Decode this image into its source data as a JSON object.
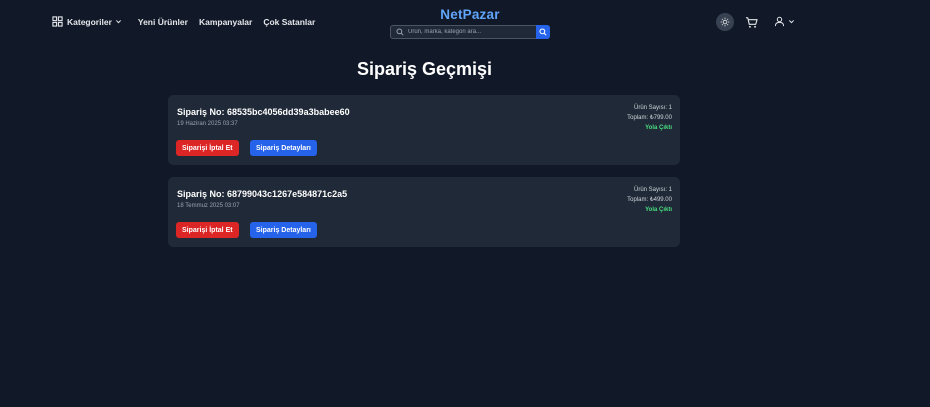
{
  "header": {
    "brand": "NetPazar",
    "nav": {
      "categories_label": "Kategoriler",
      "new_products_label": "Yeni Ürünler",
      "campaigns_label": "Kampanyalar",
      "best_sellers_label": "Çok Satanlar"
    },
    "search": {
      "placeholder": "Ürün, marka, kategori ara..."
    },
    "icons": [
      "grid-icon",
      "chevron-down-icon",
      "search-icon",
      "sun-icon",
      "cart-icon",
      "user-icon"
    ]
  },
  "page": {
    "title": "Sipariş Geçmişi"
  },
  "orders": [
    {
      "number": "Sipariş No: 68535bc4056dd39a3babee60",
      "date": "19 Haziran 2025 03:37",
      "item_count": "Ürün Sayısı: 1",
      "total": "Toplam: ₺799.00",
      "status": "Yola Çıktı",
      "cancel_label": "Siparişi İptal Et",
      "details_label": "Sipariş Detayları"
    },
    {
      "number": "Sipariş No: 68799043c1267e584871c2a5",
      "date": "18 Temmuz 2025 03:07",
      "item_count": "Ürün Sayısı: 1",
      "total": "Toplam: ₺499.00",
      "status": "Yola Çıktı",
      "cancel_label": "Siparişi İptal Et",
      "details_label": "Sipariş Detayları"
    }
  ],
  "colors": {
    "background": "#111827",
    "card": "#1f2937",
    "brand": "#60a5fa",
    "cancel": "#dc2626",
    "details": "#2563eb",
    "status": "#4ade80"
  }
}
